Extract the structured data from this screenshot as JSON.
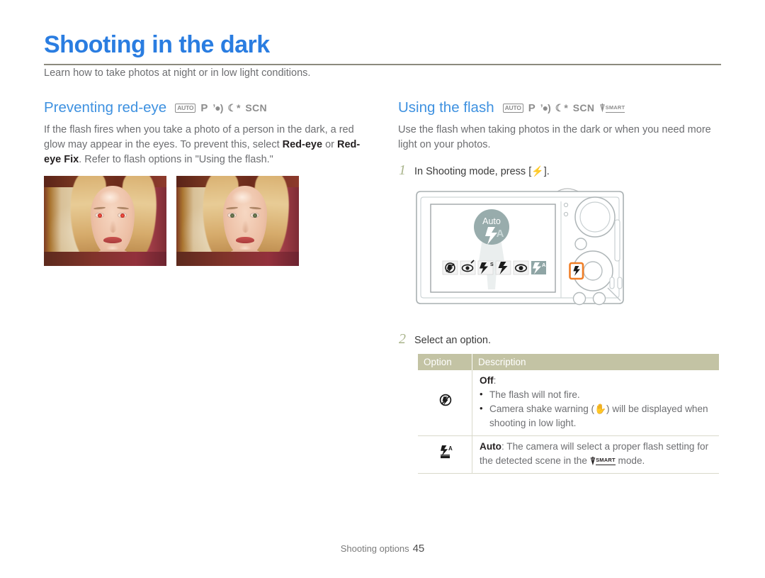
{
  "page": {
    "title": "Shooting in the dark",
    "subtitle": "Learn how to take photos at night or in low light conditions.",
    "footer_label": "Shooting options",
    "footer_page": "45",
    "accent_color": "#2a7de1",
    "section_color": "#3e91e0",
    "table_header_color": "#c3c3a4",
    "step_number_color": "#aab58c"
  },
  "left_section": {
    "heading": "Preventing red-eye",
    "mode_icons": [
      "AUTO",
      "P",
      "dual-is",
      "night",
      "SCN"
    ],
    "paragraph_parts": {
      "p1": "If the flash fires when you take a photo of a person in the dark, a red glow may appear in the eyes. To prevent this, select ",
      "b1": "Red-eye",
      "p2": " or ",
      "b2": "Red-eye Fix",
      "p3": ". Refer to flash options in \"Using the flash.\""
    },
    "photos": [
      {
        "name": "portrait-with-red-eye",
        "eye_state": "red"
      },
      {
        "name": "portrait-without-red-eye",
        "eye_state": "normal"
      }
    ]
  },
  "right_section": {
    "heading": "Using the flash",
    "mode_icons": [
      "AUTO",
      "P",
      "dual-is",
      "night",
      "SCN",
      "SMART"
    ],
    "paragraph": "Use the flash when taking photos in the dark or when you need more light on your photos.",
    "steps": [
      {
        "num": "1",
        "text_before": "In Shooting mode, press [",
        "key": "⚡",
        "text_after": "]."
      },
      {
        "num": "2",
        "text": "Select an option."
      }
    ],
    "camera": {
      "lcd_badge_label": "Auto",
      "lcd_badge_sub": "A",
      "flash_bar_icons": [
        "flash-off",
        "red-eye",
        "slow-sync",
        "fill-in",
        "red-eye-fix",
        "auto-flash"
      ],
      "selected_flash_index": 5,
      "highlighted_button": "flash-button",
      "highlight_color": "#f07e26"
    },
    "table": {
      "headers": [
        "Option",
        "Description"
      ],
      "rows": [
        {
          "icon": "flash-off-icon",
          "title": "Off",
          "title_suffix": ":",
          "bullets": [
            "The flash will not fire.",
            "Camera shake warning (✋) will be displayed when shooting in low light."
          ]
        },
        {
          "icon": "auto-flash-icon",
          "title": "Auto",
          "title_suffix": ":",
          "text_before": " The camera will select a proper flash setting for the detected scene in the ",
          "inline_icon": "SMART",
          "text_after": " mode."
        }
      ]
    }
  }
}
